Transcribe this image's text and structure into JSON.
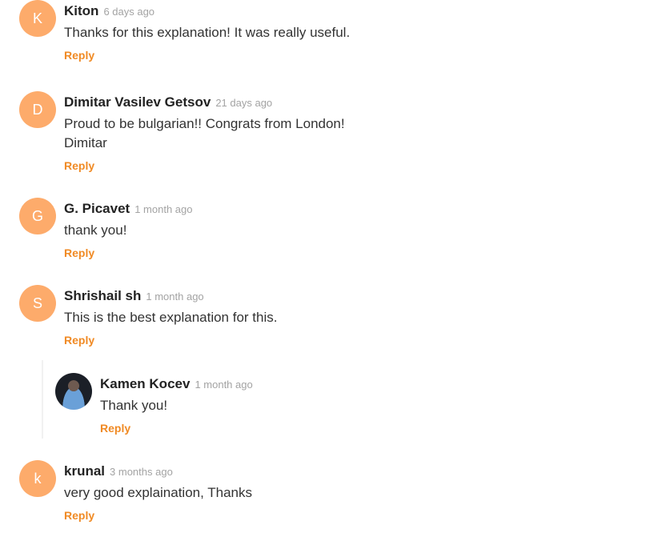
{
  "reply_label": "Reply",
  "comments": [
    {
      "initial": "K",
      "name": "Kiton",
      "time": "6 days ago",
      "text": "Thanks for this explanation! It was really useful."
    },
    {
      "initial": "D",
      "name": "Dimitar Vasilev Getsov",
      "time": "21 days ago",
      "text": "Proud to be bulgarian!! Congrats from London!",
      "text2": "Dimitar"
    },
    {
      "initial": "G",
      "name": "G. Picavet",
      "time": "1 month ago",
      "text": "thank you!"
    },
    {
      "initial": "S",
      "name": "Shrishail sh",
      "time": "1 month ago",
      "text": "This is the best explanation for this."
    },
    {
      "initial": "",
      "name": "Kamen Kocev",
      "time": "1 month ago",
      "text": "Thank you!"
    },
    {
      "initial": "k",
      "name": "krunal",
      "time": "3 months ago",
      "text": "very good explaination, Thanks"
    }
  ],
  "colors": {
    "avatar": "#fdab6b",
    "reply": "#f08a24"
  }
}
